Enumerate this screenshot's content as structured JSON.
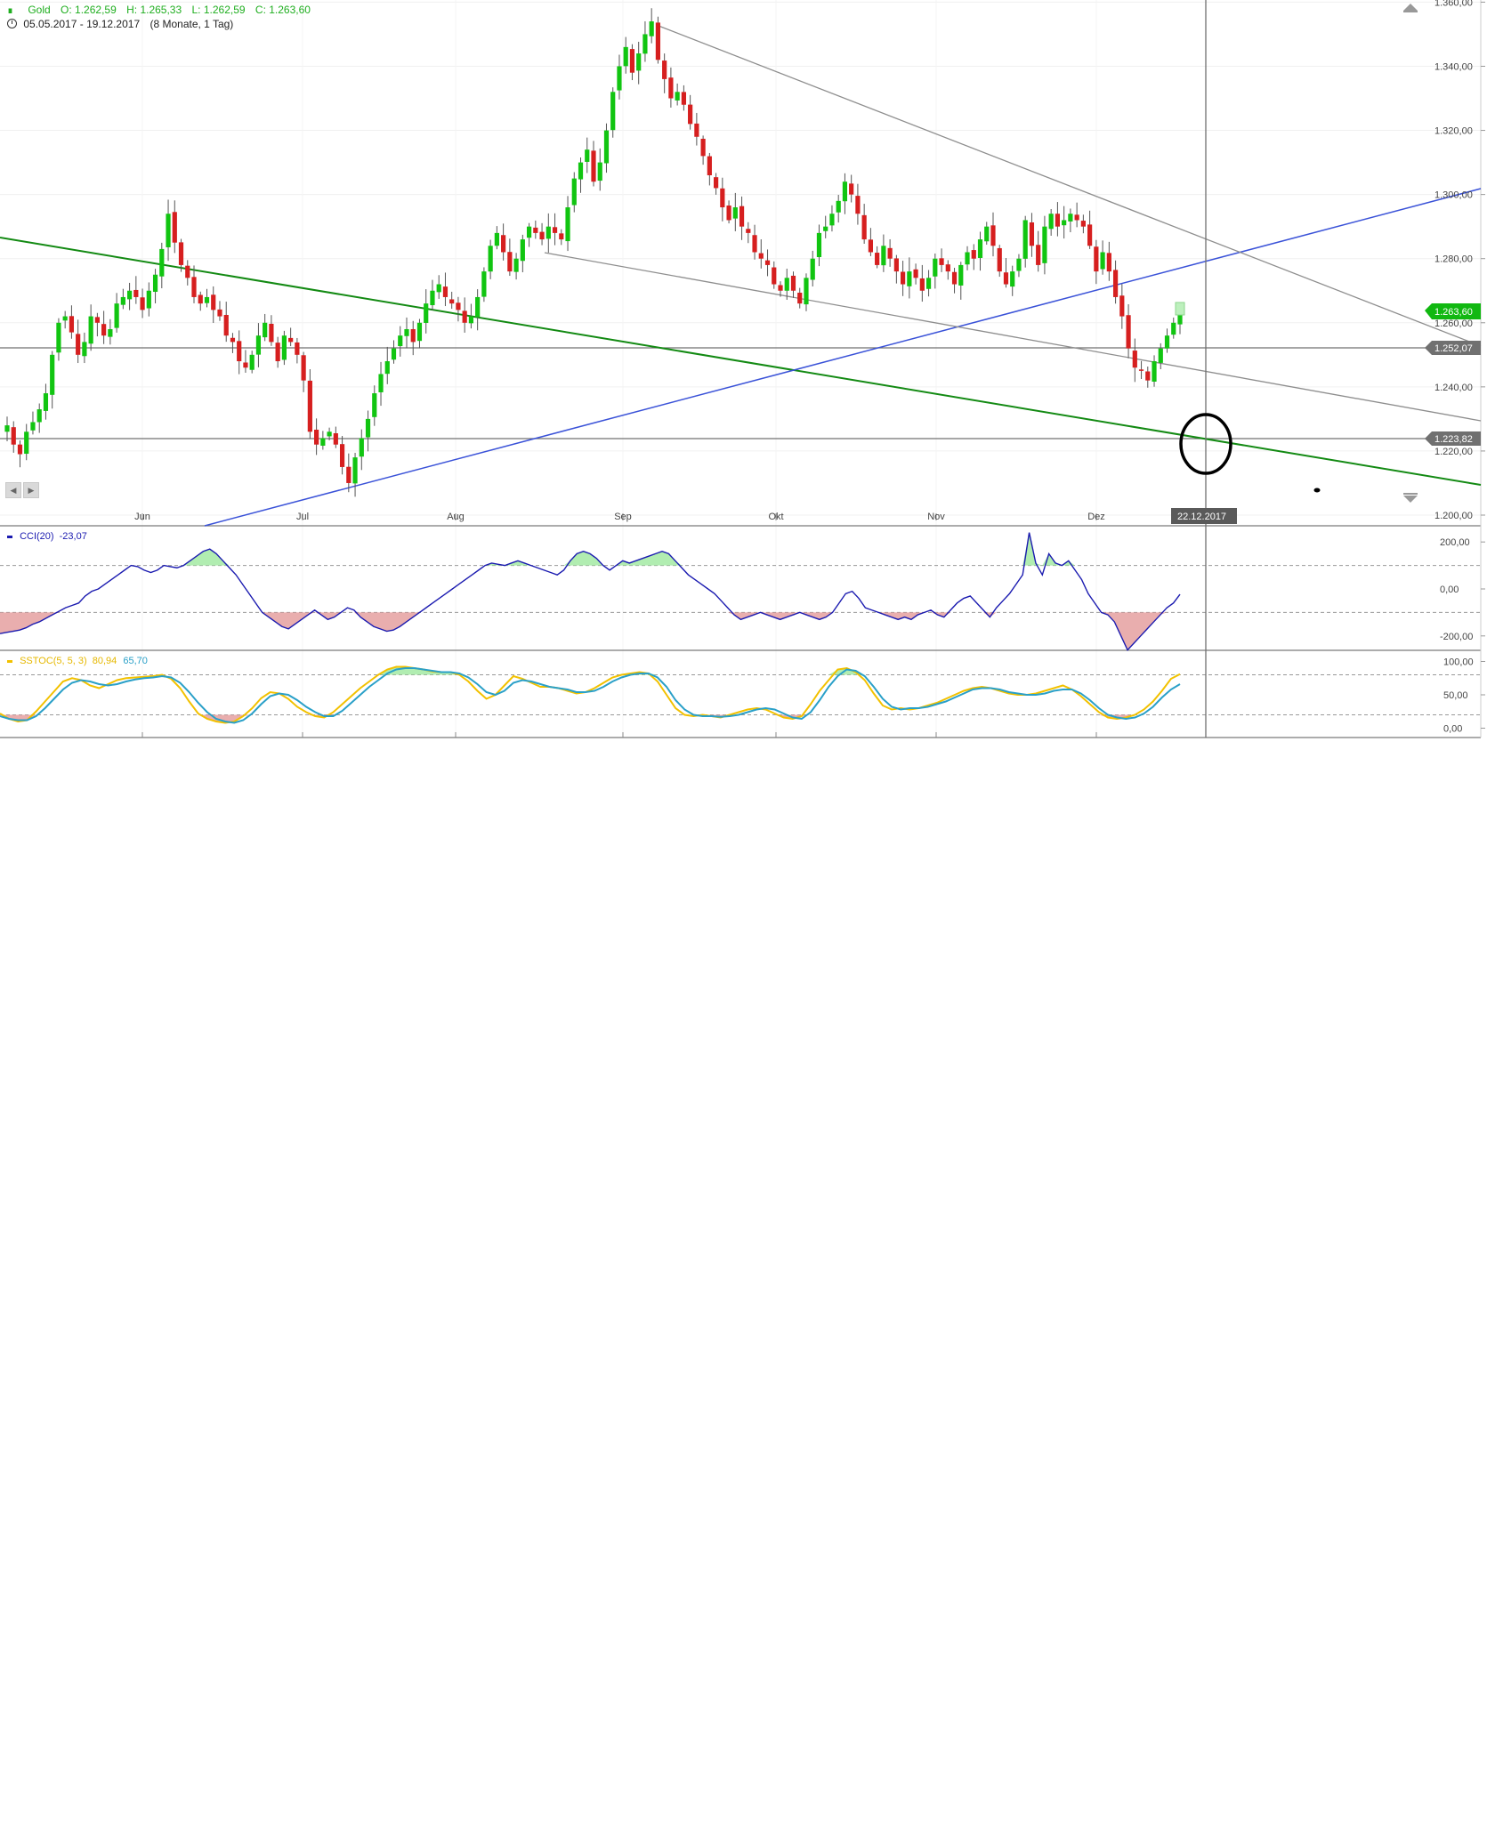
{
  "header": {
    "symbol": "Gold",
    "open": "O: 1.262,59",
    "high": "H: 1.265,33",
    "low": "L: 1.262,59",
    "close": "C: 1.263,60",
    "range": "05.05.2017 - 19.12.2017",
    "period": "(8 Monate, 1 Tag)"
  },
  "colors": {
    "up": "#11c511",
    "down": "#d61f1f",
    "green_trend": "#138a13",
    "blue_trend": "#3a52d8",
    "grey_trend": "#8e8e8e",
    "horizontal": "#707070",
    "cci_line": "#1b1bb0",
    "stoch_k": "#f2c100",
    "stoch_d": "#2aa0c8",
    "circle": "#000000"
  },
  "cursor_date": "22.12.2017",
  "price_tags": {
    "last": "1.263,60",
    "level_1": "1.252,07",
    "level_2": "1.223,82"
  },
  "indicators": {
    "cci_label": "CCI(20)",
    "cci_value": "-23,07",
    "sstoc_label": "SSTOC(5, 5, 3)",
    "sstoc_k": "80,94",
    "sstoc_d": "65,70"
  },
  "chart_data": {
    "type": "candlestick",
    "instrument": "Gold",
    "x_ticks": [
      "Jun",
      "Jul",
      "Aug",
      "Sep",
      "Okt",
      "Nov",
      "Dez"
    ],
    "y_ticks": [
      "1.200,00",
      "1.220,00",
      "1.240,00",
      "1.260,00",
      "1.280,00",
      "1.300,00",
      "1.320,00",
      "1.340,00",
      "1.360,00"
    ],
    "ylim": [
      1200,
      1364
    ],
    "closes": [
      1228,
      1222,
      1219,
      1226,
      1229,
      1233,
      1238,
      1250,
      1260,
      1262,
      1257,
      1250,
      1254,
      1262,
      1260,
      1256,
      1258,
      1266,
      1268,
      1270,
      1268,
      1264,
      1270,
      1275,
      1283,
      1294,
      1285,
      1278,
      1274,
      1268,
      1266,
      1268,
      1264,
      1262,
      1256,
      1254,
      1248,
      1246,
      1250,
      1256,
      1260,
      1254,
      1248,
      1256,
      1254,
      1250,
      1242,
      1226,
      1222,
      1224,
      1226,
      1222,
      1215,
      1210,
      1218,
      1224,
      1230,
      1238,
      1244,
      1248,
      1252,
      1256,
      1258,
      1254,
      1260,
      1266,
      1270,
      1272,
      1268,
      1266,
      1264,
      1260,
      1262,
      1268,
      1276,
      1284,
      1288,
      1282,
      1276,
      1280,
      1286,
      1290,
      1288,
      1286,
      1290,
      1288,
      1286,
      1296,
      1305,
      1310,
      1314,
      1304,
      1310,
      1320,
      1332,
      1340,
      1346,
      1338,
      1344,
      1350,
      1354,
      1342,
      1336,
      1330,
      1332,
      1328,
      1322,
      1318,
      1312,
      1306,
      1302,
      1296,
      1292,
      1296,
      1290,
      1288,
      1282,
      1280,
      1278,
      1272,
      1270,
      1274,
      1270,
      1266,
      1274,
      1280,
      1288,
      1290,
      1294,
      1298,
      1304,
      1300,
      1294,
      1286,
      1282,
      1278,
      1284,
      1280,
      1276,
      1272,
      1276,
      1274,
      1270,
      1274,
      1280,
      1278,
      1276,
      1272,
      1278,
      1282,
      1280,
      1286,
      1290,
      1284,
      1276,
      1272,
      1276,
      1280,
      1292,
      1284,
      1278,
      1290,
      1294,
      1290,
      1292,
      1294,
      1292,
      1290,
      1284,
      1276,
      1282,
      1276,
      1268,
      1262,
      1252,
      1246,
      1245,
      1242,
      1248,
      1252,
      1256,
      1260,
      1264
    ],
    "horizontal_levels": [
      1252.07,
      1223.82
    ],
    "series": [
      {
        "name": "CCI(20)",
        "ylim": [
          -250,
          250
        ],
        "y_ticks": [
          "200,00",
          "0,00",
          "-200,00"
        ],
        "levels": [
          100,
          -100
        ],
        "values": [
          -190,
          -185,
          -180,
          -175,
          -165,
          -150,
          -140,
          -125,
          -110,
          -95,
          -80,
          -70,
          -60,
          -30,
          -10,
          0,
          20,
          40,
          60,
          80,
          100,
          95,
          80,
          70,
          80,
          100,
          95,
          90,
          100,
          120,
          140,
          160,
          170,
          150,
          120,
          90,
          60,
          20,
          -20,
          -60,
          -100,
          -120,
          -140,
          -160,
          -170,
          -150,
          -130,
          -110,
          -90,
          -110,
          -130,
          -120,
          -100,
          -80,
          -90,
          -120,
          -140,
          -160,
          -170,
          -180,
          -175,
          -160,
          -140,
          -120,
          -100,
          -80,
          -60,
          -40,
          -20,
          0,
          20,
          40,
          60,
          80,
          100,
          110,
          105,
          100,
          110,
          120,
          110,
          100,
          90,
          80,
          70,
          60,
          80,
          120,
          150,
          160,
          150,
          130,
          100,
          80,
          100,
          120,
          110,
          120,
          130,
          140,
          150,
          160,
          150,
          120,
          90,
          60,
          40,
          20,
          0,
          -20,
          -50,
          -80,
          -110,
          -130,
          -120,
          -110,
          -100,
          -110,
          -120,
          -130,
          -120,
          -110,
          -100,
          -110,
          -120,
          -130,
          -120,
          -100,
          -60,
          -20,
          -10,
          -40,
          -80,
          -90,
          -100,
          -110,
          -120,
          -130,
          -120,
          -130,
          -110,
          -100,
          -90,
          -110,
          -120,
          -90,
          -60,
          -40,
          -30,
          -60,
          -90,
          -120,
          -80,
          -50,
          -20,
          20,
          60,
          240,
          110,
          60,
          150,
          110,
          100,
          120,
          80,
          40,
          -20,
          -60,
          -100,
          -110,
          -140,
          -200,
          -260,
          -230,
          -200,
          -170,
          -140,
          -110,
          -80,
          -60,
          -23
        ]
      },
      {
        "name": "SSTOC(5, 5, 3)",
        "ylim": [
          -10,
          110
        ],
        "y_ticks": [
          "100,00",
          "50,00",
          "0,00"
        ],
        "levels": [
          80,
          20
        ],
        "values": [
          22,
          14,
          10,
          12,
          25,
          40,
          55,
          70,
          75,
          72,
          64,
          60,
          66,
          72,
          75,
          76,
          77,
          78,
          80,
          74,
          60,
          40,
          22,
          14,
          10,
          8,
          10,
          18,
          30,
          45,
          54,
          52,
          44,
          32,
          24,
          18,
          16,
          24,
          36,
          48,
          60,
          70,
          80,
          88,
          92,
          92,
          90,
          88,
          85,
          84,
          84,
          80,
          70,
          56,
          44,
          50,
          64,
          78,
          74,
          68,
          62,
          62,
          60,
          56,
          52,
          54,
          60,
          68,
          76,
          80,
          82,
          84,
          82,
          70,
          50,
          30,
          20,
          18,
          20,
          18,
          16,
          20,
          24,
          28,
          30,
          28,
          22,
          16,
          14,
          18,
          36,
          56,
          72,
          88,
          90,
          84,
          72,
          52,
          34,
          28,
          30,
          28,
          30,
          34,
          38,
          44,
          50,
          56,
          60,
          62,
          60,
          56,
          52,
          50,
          50,
          52,
          56,
          60,
          64,
          58,
          48,
          36,
          24,
          16,
          14,
          16,
          20,
          28,
          40,
          56,
          74,
          81
        ]
      },
      {
        "name": "SSTOC signal",
        "values": [
          18,
          14,
          12,
          12,
          18,
          30,
          44,
          58,
          68,
          72,
          70,
          66,
          64,
          66,
          70,
          73,
          75,
          76,
          78,
          76,
          68,
          54,
          38,
          24,
          14,
          10,
          8,
          12,
          22,
          36,
          48,
          52,
          50,
          42,
          32,
          24,
          18,
          18,
          26,
          38,
          50,
          62,
          72,
          82,
          88,
          90,
          90,
          88,
          86,
          84,
          84,
          82,
          76,
          66,
          54,
          50,
          56,
          68,
          72,
          70,
          66,
          62,
          60,
          58,
          54,
          54,
          56,
          62,
          70,
          76,
          80,
          82,
          82,
          76,
          62,
          42,
          28,
          20,
          18,
          18,
          17,
          18,
          20,
          24,
          28,
          30,
          28,
          22,
          16,
          14,
          24,
          42,
          62,
          78,
          88,
          86,
          78,
          62,
          44,
          32,
          28,
          30,
          30,
          32,
          36,
          40,
          46,
          52,
          58,
          60,
          60,
          58,
          54,
          52,
          50,
          50,
          52,
          56,
          58,
          58,
          52,
          42,
          30,
          20,
          16,
          14,
          16,
          22,
          32,
          46,
          58,
          66
        ]
      }
    ]
  }
}
